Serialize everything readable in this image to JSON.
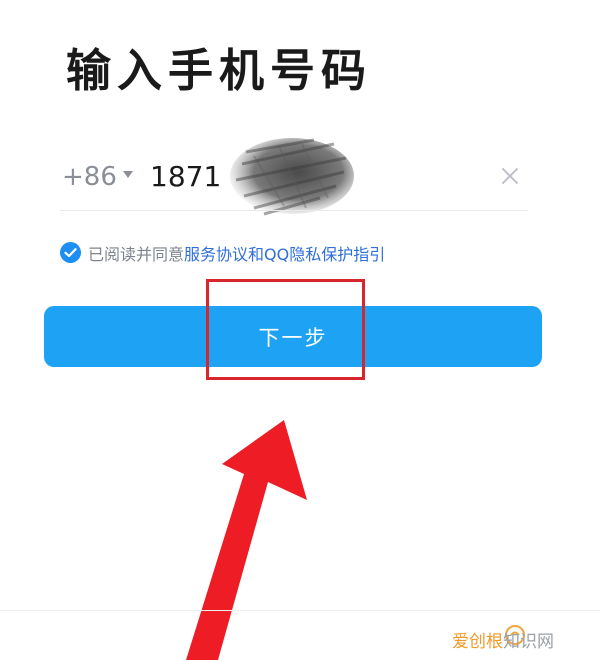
{
  "header": {
    "title": "输入手机号码"
  },
  "phone_form": {
    "country_code": "+86",
    "phone_value": "1871"
  },
  "agreement": {
    "prefix": "已阅读并同意",
    "terms_link": "服务协议",
    "connector": "和",
    "privacy_link": "QQ隐私保护指引",
    "checked": true
  },
  "actions": {
    "next_label": "下一步"
  },
  "watermark": {
    "brand": "爱创根",
    "site": "知识网"
  },
  "colors": {
    "primary": "#1ea3f4",
    "link": "#2f6fd8",
    "highlight": "#d7262e",
    "check": "#1d8ff2"
  }
}
